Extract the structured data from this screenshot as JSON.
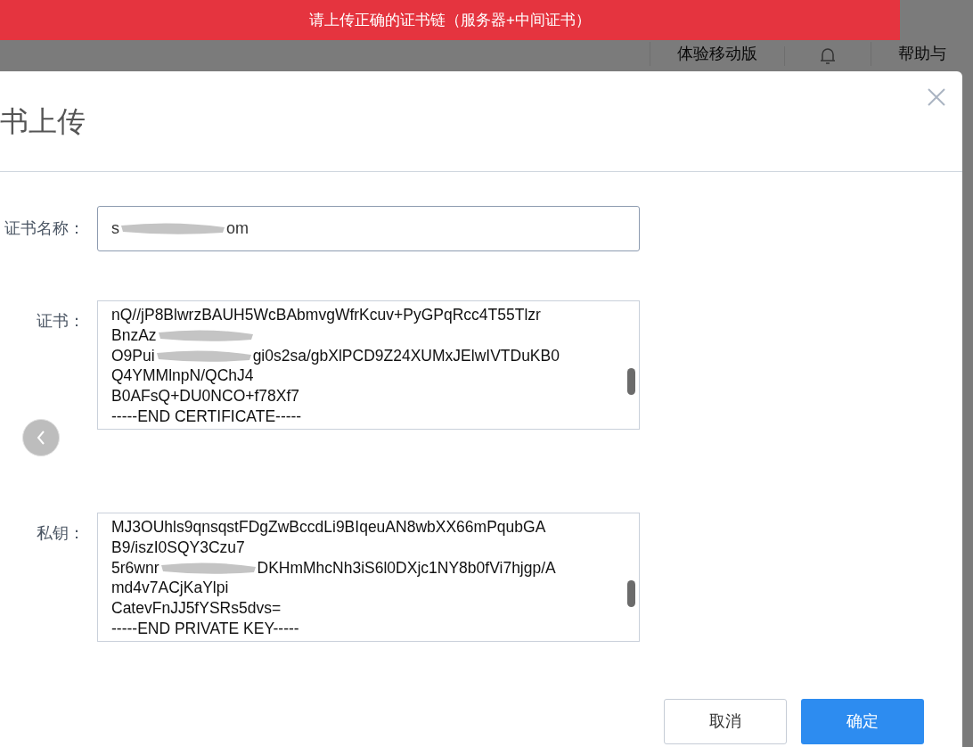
{
  "toast": {
    "message": "请上传正确的证书链（服务器+中间证书）"
  },
  "header": {
    "items": [
      {
        "kind": "text",
        "label": "体验移动版"
      },
      {
        "kind": "bell"
      },
      {
        "kind": "text",
        "label": "帮助与"
      }
    ]
  },
  "dialog": {
    "title": "书上传",
    "fields": [
      {
        "kind": "input",
        "label": "证书名称：",
        "value_parts": [
          "s",
          "om"
        ]
      },
      {
        "kind": "textarea",
        "label": "证书：",
        "lines": [
          {
            "parts": [
              "nQ//jP8BlwrzBAUH5WcBAbmvgWfrKcuv+PyGPqRcc4T55Tlzr"
            ]
          },
          {
            "parts": [
              "BnzAz"
            ],
            "redacted": true
          },
          {
            "parts": [
              "O9Pui",
              "gi0s2sa/gbXlPCD9Z24XUMxJElwIVTDuKB0"
            ]
          },
          {
            "parts": [
              "Q4YMMlnpN/QChJ4"
            ]
          },
          {
            "parts": [
              "B0AFsQ+DU0NCO+f78Xf7"
            ]
          },
          {
            "parts": [
              "-----END CERTIFICATE-----"
            ]
          }
        ]
      },
      {
        "kind": "textarea",
        "label": "私钥：",
        "lines": [
          {
            "parts": [
              "MJ3OUhls9qnsqstFDgZwBccdLi9BIqeuAN8wbXX66mPqubGA"
            ]
          },
          {
            "parts": [
              "B9/iszI0SQY3Czu7"
            ]
          },
          {
            "parts": [
              "5r6wnr",
              "DKHmMhcNh3iS6l0DXjc1NY8b0fVi7hjgp/A"
            ]
          },
          {
            "parts": [
              "md4v7ACjKaYlpi"
            ]
          },
          {
            "parts": [
              "CatevFnJJ5fYSRs5dvs="
            ]
          },
          {
            "parts": [
              "-----END PRIVATE KEY-----"
            ]
          }
        ]
      }
    ],
    "buttons": [
      {
        "label": "取消",
        "kind": "secondary"
      },
      {
        "label": "确定",
        "kind": "primary"
      }
    ]
  }
}
